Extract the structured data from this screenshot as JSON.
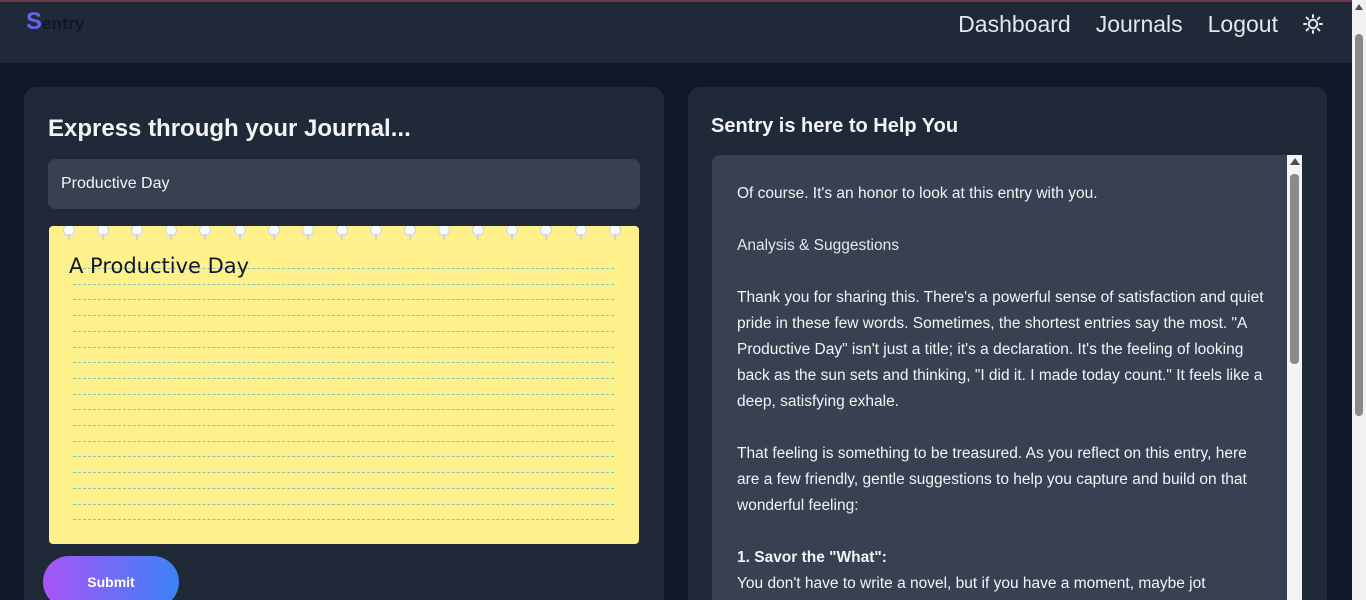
{
  "navbar": {
    "logo_initial": "S",
    "logo_rest": "entry",
    "links": [
      "Dashboard",
      "Journals",
      "Logout"
    ],
    "theme_icon": "sun-icon"
  },
  "journal": {
    "heading": "Express through your Journal...",
    "title_value": "Productive Day",
    "notepad_text": "A Productive Day",
    "submit_label": "Submit"
  },
  "assistant": {
    "heading": "Sentry is here to Help You",
    "paragraphs": [
      "Of course. It's an honor to look at this entry with you.",
      "Analysis & Suggestions",
      "Thank you for sharing this. There's a powerful sense of satisfaction and quiet pride in these few words. Sometimes, the shortest entries say the most. \"A Productive Day\" isn't just a title; it's a declaration. It's the feeling of looking back as the sun sets and thinking, \"I did it. I made today count.\" It feels like a deep, satisfying exhale.",
      "That feeling is something to be treasured. As you reflect on this entry, here are a few friendly, gentle suggestions to help you capture and build on that wonderful feeling:"
    ],
    "point_title": "1. Savor the \"What\":",
    "point_text": "You don't have to write a novel, but if you have a moment, maybe jot"
  },
  "colors": {
    "background": "#111827",
    "card": "#1f2937",
    "input": "#374151",
    "notepad": "#fef08a",
    "accent_start": "#a855f7",
    "accent_end": "#3b82f6",
    "logo": "#6366f1"
  }
}
